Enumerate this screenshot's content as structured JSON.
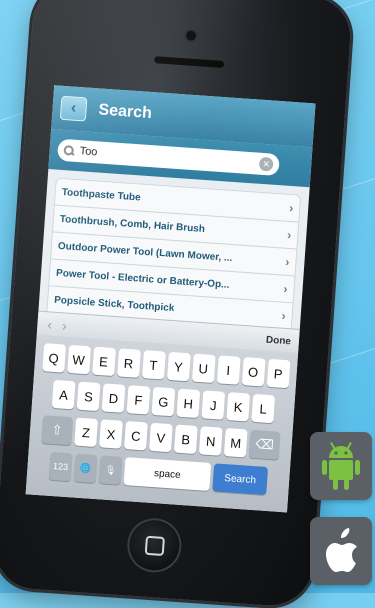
{
  "nav": {
    "back_glyph": "‹",
    "title": "Search"
  },
  "search": {
    "value": "Too",
    "clear_glyph": "✕"
  },
  "results": [
    {
      "label": "Toothpaste Tube"
    },
    {
      "label": "Toothbrush, Comb, Hair Brush"
    },
    {
      "label": "Outdoor Power Tool (Lawn Mower, ..."
    },
    {
      "label": "Power Tool - Electric or Battery-Op..."
    },
    {
      "label": "Popsicle Stick, Toothpick"
    }
  ],
  "toolbar": {
    "prev_glyph": "‹",
    "next_glyph": "›",
    "done": "Done"
  },
  "keyboard": {
    "row1": [
      "Q",
      "W",
      "E",
      "R",
      "T",
      "Y",
      "U",
      "I",
      "O",
      "P"
    ],
    "row2": [
      "A",
      "S",
      "D",
      "F",
      "G",
      "H",
      "J",
      "K",
      "L"
    ],
    "row3": [
      "Z",
      "X",
      "C",
      "V",
      "B",
      "N",
      "M"
    ],
    "shift": "⇧",
    "backspace": "⌫",
    "numbers": "123",
    "globe": "🌐",
    "mic": "🎙",
    "space": "space",
    "search": "Search"
  },
  "platforms": [
    "android-icon",
    "apple-icon"
  ],
  "colors": {
    "nav_bar": "#3a82a6",
    "search_key": "#3d7ed0",
    "background": "#66c6ee"
  }
}
